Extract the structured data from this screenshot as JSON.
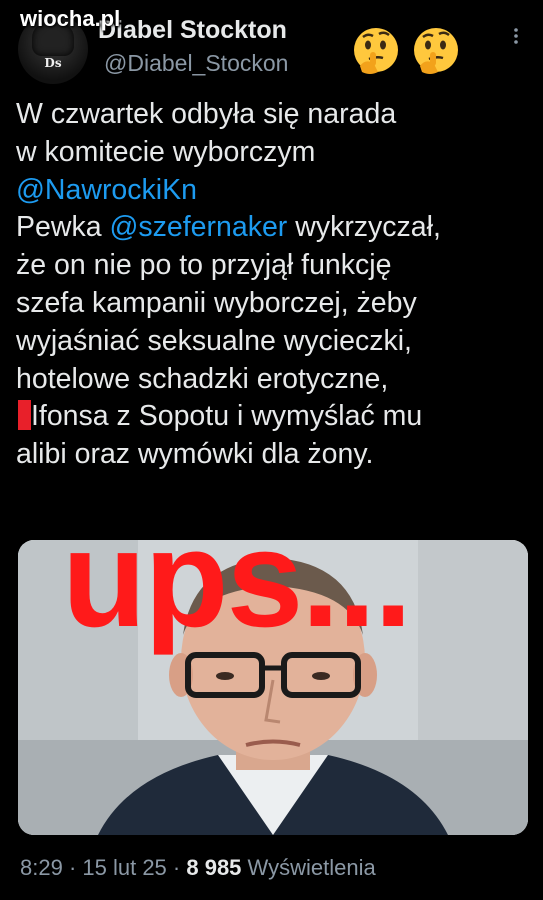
{
  "watermark": "wiocha.pl",
  "author": {
    "display_name": "Diabel Stockton",
    "display_name_visible": "Diabel Stockton",
    "handle": "@Diabel_Stockon",
    "avatar_text": "Ds"
  },
  "header_emojis": [
    "thinking-face-icon",
    "thinking-face-icon"
  ],
  "tweet": {
    "lines": [
      {
        "parts": [
          {
            "text": "W czwartek odbyła się narada",
            "type": "text"
          }
        ]
      },
      {
        "parts": [
          {
            "text": "w komitecie wyborczym",
            "type": "text"
          }
        ]
      },
      {
        "parts": [
          {
            "text": "@NawrockiKn",
            "type": "mention"
          }
        ]
      },
      {
        "parts": [
          {
            "text": "Pewka ",
            "type": "text"
          },
          {
            "text": "@szefernaker",
            "type": "mention"
          },
          {
            "text": " wykrzyczał,",
            "type": "text"
          }
        ]
      },
      {
        "parts": [
          {
            "text": "że on nie po to przyjął funkcję",
            "type": "text"
          }
        ]
      },
      {
        "parts": [
          {
            "text": "szefa kampanii wyborczej, żeby",
            "type": "text"
          }
        ]
      },
      {
        "parts": [
          {
            "text": "wyjaśniać seksualne wycieczki,",
            "type": "text"
          }
        ]
      },
      {
        "parts": [
          {
            "text": "hotelowe schadzki erotyczne,",
            "type": "text"
          }
        ]
      },
      {
        "parts": [
          {
            "text": "Ifonsa z Sopotu i wymyślać mu",
            "type": "text"
          }
        ]
      },
      {
        "parts": [
          {
            "text": "alibi oraz wymówki dla żony.",
            "type": "text"
          }
        ]
      }
    ]
  },
  "overlay_text": "ups...",
  "meta": {
    "time": "8:29",
    "sep1": " · ",
    "date": "15 lut 25",
    "sep2": " · ",
    "views_count": "8 985",
    "views_label": " Wyświetlenia"
  },
  "colors": {
    "background": "#000000",
    "text": "#e7e9ea",
    "secondary": "#8b98a5",
    "mention": "#1d9bf0",
    "overlay_red": "#ff1a1a"
  }
}
